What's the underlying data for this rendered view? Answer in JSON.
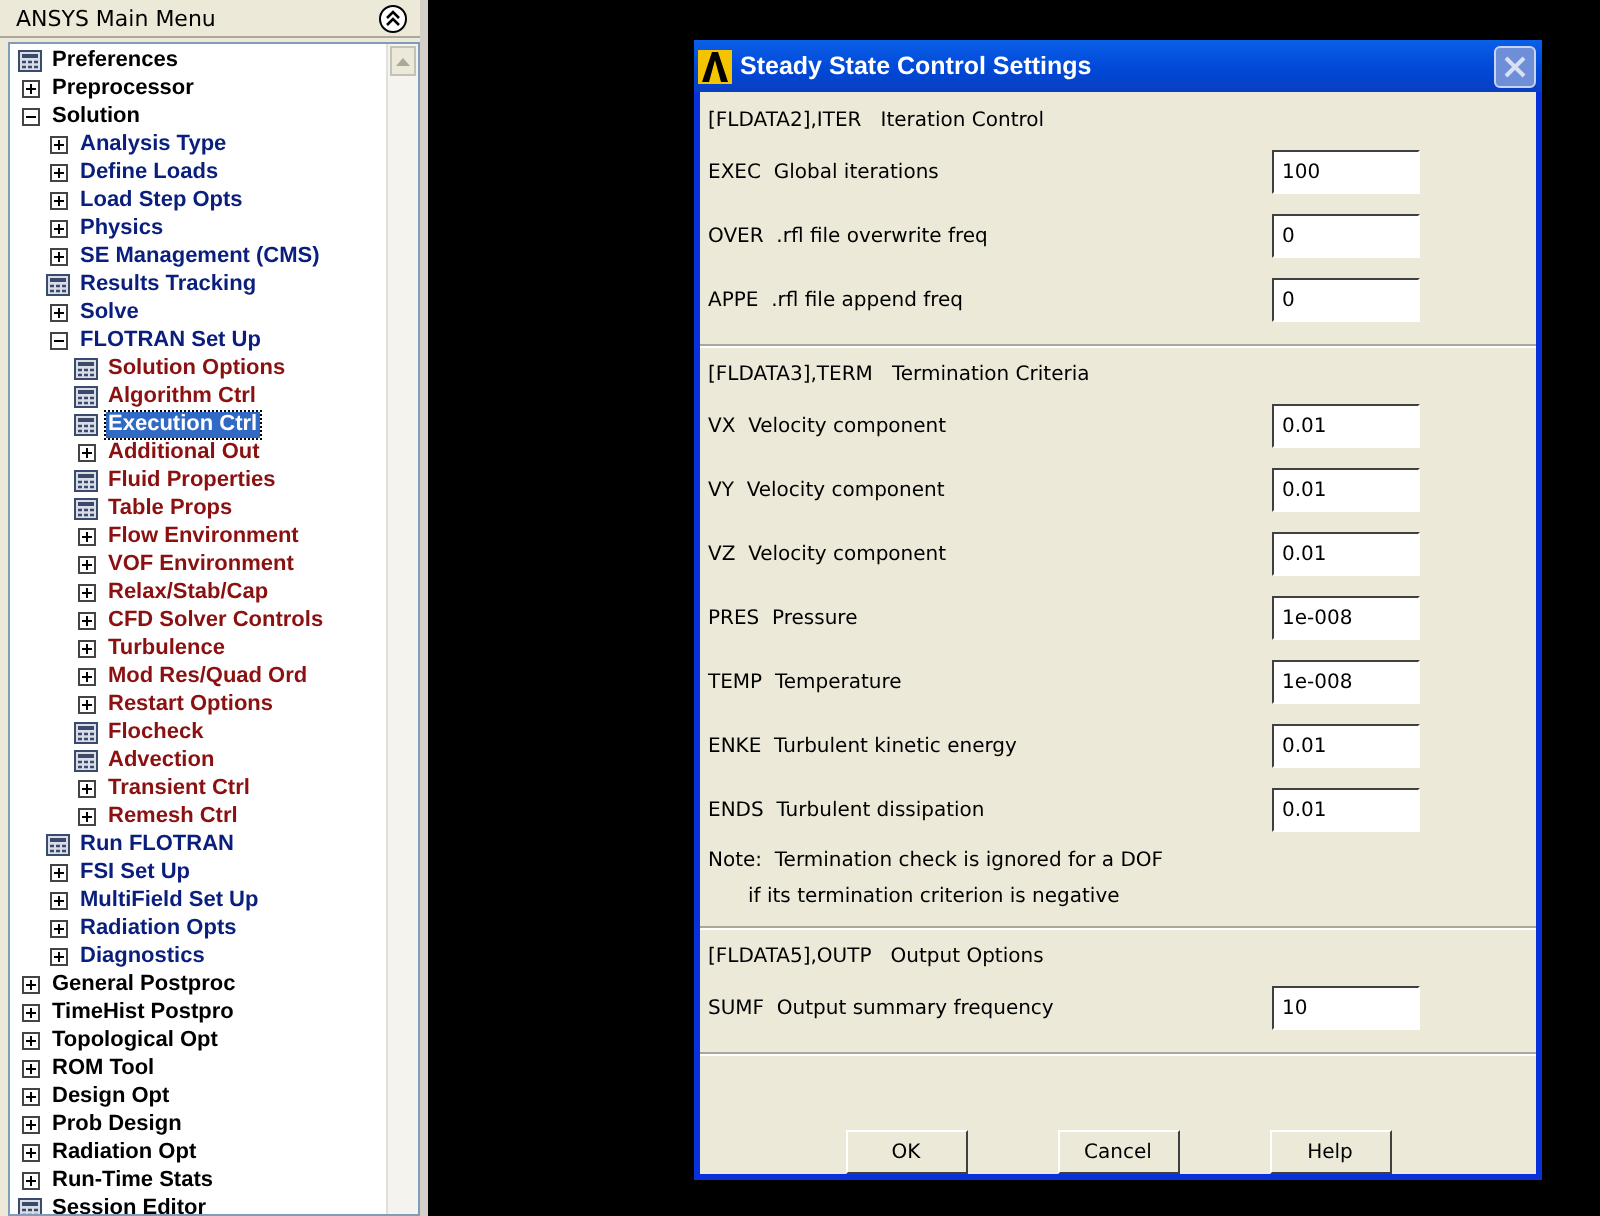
{
  "menu": {
    "title": "ANSYS Main Menu",
    "tree": [
      {
        "label": "Preferences",
        "kind": "command",
        "selected": false
      },
      {
        "label": "Preprocessor",
        "kind": "folder",
        "expanded": false,
        "selected": false
      },
      {
        "label": "Solution",
        "kind": "folder",
        "expanded": true,
        "selected": false,
        "children": [
          {
            "label": "Analysis Type",
            "kind": "folder",
            "expanded": false,
            "selected": false
          },
          {
            "label": "Define Loads",
            "kind": "folder",
            "expanded": false,
            "selected": false
          },
          {
            "label": "Load Step Opts",
            "kind": "folder",
            "expanded": false,
            "selected": false
          },
          {
            "label": "Physics",
            "kind": "folder",
            "expanded": false,
            "selected": false
          },
          {
            "label": "SE Management (CMS)",
            "kind": "folder",
            "expanded": false,
            "selected": false
          },
          {
            "label": "Results Tracking",
            "kind": "command",
            "selected": false
          },
          {
            "label": "Solve",
            "kind": "folder",
            "expanded": false,
            "selected": false
          },
          {
            "label": "FLOTRAN Set Up",
            "kind": "folder",
            "expanded": true,
            "selected": false,
            "children": [
              {
                "label": "Solution Options",
                "kind": "command",
                "selected": false
              },
              {
                "label": "Algorithm Ctrl",
                "kind": "command",
                "selected": false
              },
              {
                "label": "Execution Ctrl",
                "kind": "command",
                "selected": true
              },
              {
                "label": "Additional Out",
                "kind": "folder",
                "expanded": false,
                "selected": false
              },
              {
                "label": "Fluid Properties",
                "kind": "command",
                "selected": false
              },
              {
                "label": "Table Props",
                "kind": "command",
                "selected": false
              },
              {
                "label": "Flow Environment",
                "kind": "folder",
                "expanded": false,
                "selected": false
              },
              {
                "label": "VOF Environment",
                "kind": "folder",
                "expanded": false,
                "selected": false
              },
              {
                "label": "Relax/Stab/Cap",
                "kind": "folder",
                "expanded": false,
                "selected": false
              },
              {
                "label": "CFD Solver Controls",
                "kind": "folder",
                "expanded": false,
                "selected": false
              },
              {
                "label": "Turbulence",
                "kind": "folder",
                "expanded": false,
                "selected": false
              },
              {
                "label": "Mod Res/Quad Ord",
                "kind": "folder",
                "expanded": false,
                "selected": false
              },
              {
                "label": "Restart Options",
                "kind": "folder",
                "expanded": false,
                "selected": false
              },
              {
                "label": "Flocheck",
                "kind": "command",
                "selected": false
              },
              {
                "label": "Advection",
                "kind": "command",
                "selected": false
              },
              {
                "label": "Transient Ctrl",
                "kind": "folder",
                "expanded": false,
                "selected": false
              },
              {
                "label": "Remesh Ctrl",
                "kind": "folder",
                "expanded": false,
                "selected": false
              }
            ]
          },
          {
            "label": "Run FLOTRAN",
            "kind": "command",
            "selected": false
          },
          {
            "label": "FSI Set Up",
            "kind": "folder",
            "expanded": false,
            "selected": false
          },
          {
            "label": "MultiField Set Up",
            "kind": "folder",
            "expanded": false,
            "selected": false
          },
          {
            "label": "Radiation Opts",
            "kind": "folder",
            "expanded": false,
            "selected": false
          },
          {
            "label": "Diagnostics",
            "kind": "folder",
            "expanded": false,
            "selected": false
          }
        ]
      },
      {
        "label": "General Postproc",
        "kind": "folder",
        "expanded": false,
        "selected": false
      },
      {
        "label": "TimeHist Postpro",
        "kind": "folder",
        "expanded": false,
        "selected": false
      },
      {
        "label": "Topological Opt",
        "kind": "folder",
        "expanded": false,
        "selected": false
      },
      {
        "label": "ROM Tool",
        "kind": "folder",
        "expanded": false,
        "selected": false
      },
      {
        "label": "Design Opt",
        "kind": "folder",
        "expanded": false,
        "selected": false
      },
      {
        "label": "Prob Design",
        "kind": "folder",
        "expanded": false,
        "selected": false
      },
      {
        "label": "Radiation Opt",
        "kind": "folder",
        "expanded": false,
        "selected": false
      },
      {
        "label": "Run-Time Stats",
        "kind": "folder",
        "expanded": false,
        "selected": false
      },
      {
        "label": "Session Editor",
        "kind": "command",
        "selected": false
      }
    ]
  },
  "dialog": {
    "title": "Steady State Control Settings",
    "sections": [
      {
        "header": "[FLDATA2],ITER   Iteration Control",
        "rows": [
          {
            "code": "EXEC",
            "label": "Global iterations",
            "value": "100"
          },
          {
            "code": "OVER",
            "label": ".rfl file overwrite freq",
            "value": "0"
          },
          {
            "code": "APPE",
            "label": ".rfl file append freq",
            "value": "0"
          }
        ]
      },
      {
        "header": "[FLDATA3],TERM   Termination Criteria",
        "rows": [
          {
            "code": "VX",
            "label": "Velocity component",
            "value": "0.01"
          },
          {
            "code": "VY",
            "label": "Velocity component",
            "value": "0.01"
          },
          {
            "code": "VZ",
            "label": "Velocity component",
            "value": "0.01"
          },
          {
            "code": "PRES",
            "label": "Pressure",
            "value": "1e-008"
          },
          {
            "code": "TEMP",
            "label": "Temperature",
            "value": "1e-008"
          },
          {
            "code": "ENKE",
            "label": "Turbulent kinetic energy",
            "value": "0.01"
          },
          {
            "code": "ENDS",
            "label": "Turbulent dissipation",
            "value": "0.01"
          }
        ],
        "notes": [
          "Note:  Termination check is ignored for a DOF",
          "if its termination criterion is negative"
        ]
      },
      {
        "header": "[FLDATA5],OUTP   Output Options",
        "rows": [
          {
            "code": "SUMF",
            "label": "Output summary frequency",
            "value": "10"
          }
        ]
      }
    ],
    "buttons": [
      "OK",
      "Cancel",
      "Help"
    ]
  }
}
